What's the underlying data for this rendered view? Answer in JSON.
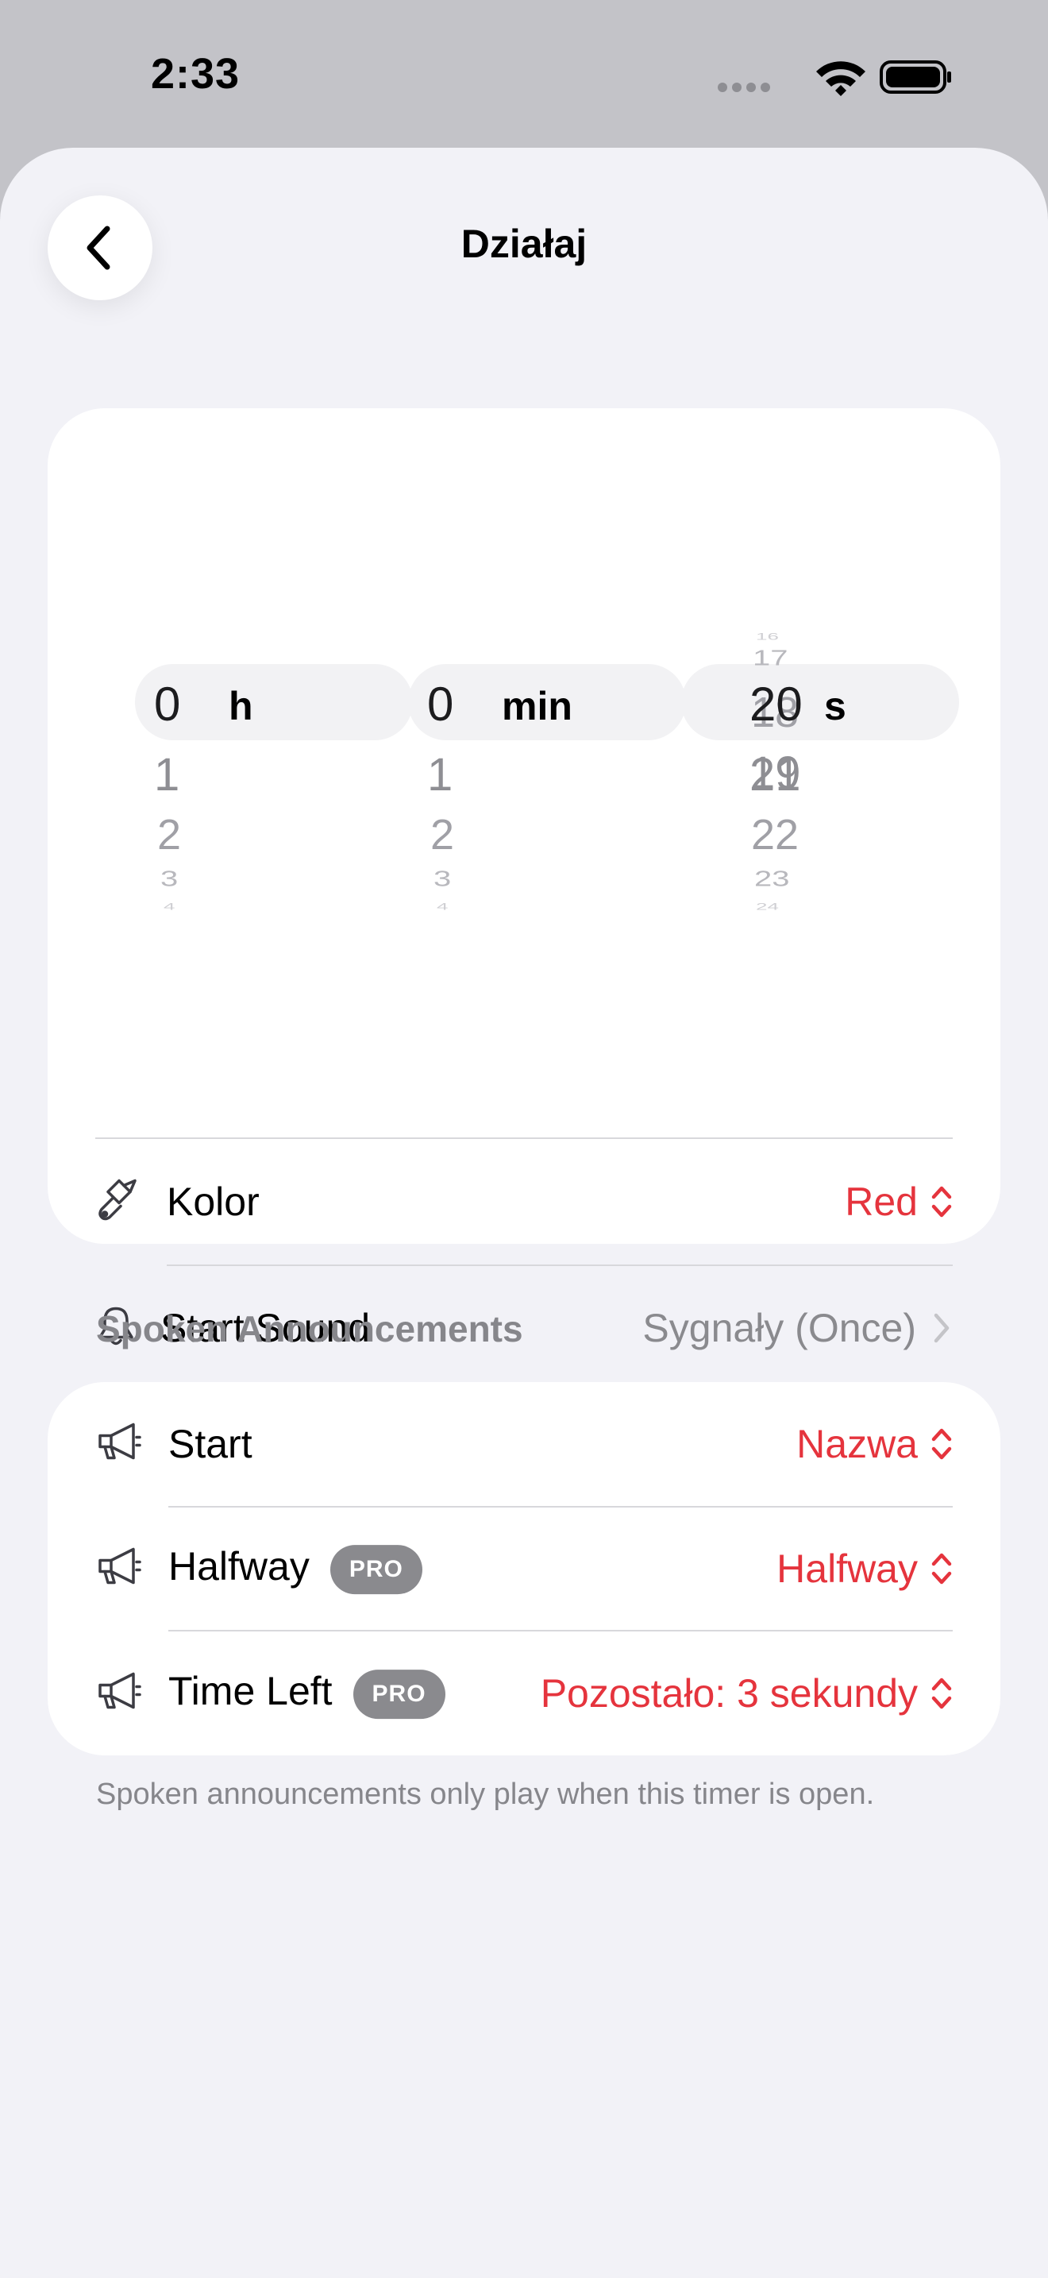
{
  "status_bar": {
    "time": "2:33"
  },
  "nav": {
    "title": "Działaj"
  },
  "picker": {
    "hours": {
      "selected": "0",
      "unit": "h",
      "below": [
        "1",
        "2",
        "3",
        "4"
      ]
    },
    "minutes": {
      "selected": "0",
      "unit": "min",
      "below": [
        "1",
        "2",
        "3",
        "4"
      ]
    },
    "seconds": {
      "selected": "20",
      "unit": "s",
      "above": [
        "16",
        "17",
        "18",
        "19"
      ],
      "below": [
        "21",
        "22",
        "23",
        "24"
      ]
    }
  },
  "settings": {
    "color": {
      "label": "Kolor",
      "value": "Red",
      "icon": "paintbrush-icon"
    },
    "start_sound": {
      "label": "Start Sound",
      "value": "Sygnały (Once)",
      "icon": "bell-icon"
    }
  },
  "spoken": {
    "header": "Spoken Announcements",
    "items": [
      {
        "label": "Start",
        "value": "Nazwa",
        "badge": "",
        "icon": "megaphone-icon"
      },
      {
        "label": "Halfway",
        "value": "Halfway",
        "badge": "PRO",
        "icon": "megaphone-icon"
      },
      {
        "label": "Time Left",
        "value": "Pozostało: 3 sekundy",
        "badge": "PRO",
        "icon": "megaphone-icon"
      }
    ],
    "footer": "Spoken announcements only play when this timer is open."
  },
  "colors": {
    "accent": "#e5343d",
    "secondary": "#8a8a8e",
    "background": "#f2f2f7"
  }
}
